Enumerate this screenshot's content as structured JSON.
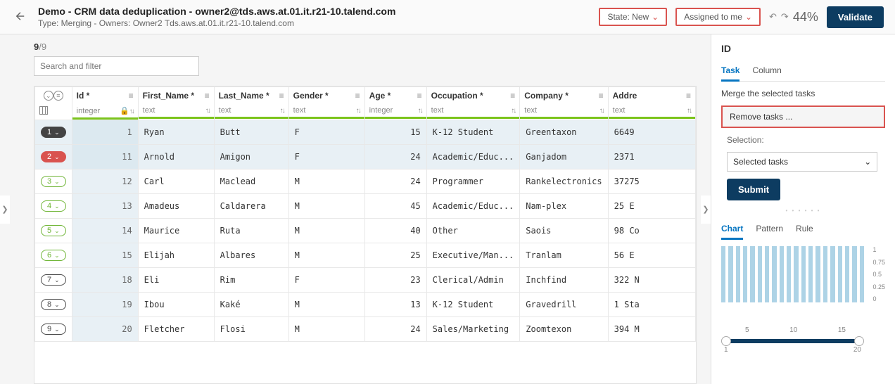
{
  "header": {
    "title": "Demo - CRM data deduplication - owner2@tds.aws.at.01.it.r21-10.talend.com",
    "subtitle": "Type: Merging - Owners: Owner2 Tds.aws.at.01.it.r21-10.talend.com",
    "state": "State: New",
    "assigned": "Assigned to me",
    "percent": "44%",
    "validate": "Validate"
  },
  "count": {
    "n": "9",
    "total": "/9"
  },
  "search_placeholder": "Search and filter",
  "columns": [
    {
      "name": "",
      "type": ""
    },
    {
      "name": "Id *",
      "type": "integer",
      "lock": true
    },
    {
      "name": "First_Name *",
      "type": "text"
    },
    {
      "name": "Last_Name *",
      "type": "text"
    },
    {
      "name": "Gender *",
      "type": "text"
    },
    {
      "name": "Age *",
      "type": "integer"
    },
    {
      "name": "Occupation *",
      "type": "text"
    },
    {
      "name": "Company *",
      "type": "text"
    },
    {
      "name": "Addre",
      "type": "text"
    }
  ],
  "rows": [
    {
      "pill": "1",
      "pillClass": "dark",
      "hl": true,
      "id": "1",
      "fn": "Ryan",
      "ln": "Butt",
      "g": "F",
      "age": "15",
      "occ": "K-12 Student",
      "co": "Greentaxon",
      "addr": "6649"
    },
    {
      "pill": "2",
      "pillClass": "red",
      "hl": true,
      "id": "11",
      "fn": "Arnold",
      "ln": "Amigon",
      "g": "F",
      "age": "24",
      "occ": "Academic/Educ...",
      "co": "Ganjadom",
      "addr": "2371"
    },
    {
      "pill": "3",
      "pillClass": "green",
      "id": "12",
      "fn": "Carl",
      "ln": "Maclead",
      "g": "M",
      "age": "24",
      "occ": "Programmer",
      "co": "Rankelectronics",
      "addr": "37275"
    },
    {
      "pill": "4",
      "pillClass": "green",
      "id": "13",
      "fn": "Amadeus",
      "ln": "Caldarera",
      "g": "M",
      "age": "45",
      "occ": "Academic/Educ...",
      "co": "Nam-plex",
      "addr": "25 E"
    },
    {
      "pill": "5",
      "pillClass": "green",
      "id": "14",
      "fn": "Maurice",
      "ln": "Ruta",
      "g": "M",
      "age": "40",
      "occ": "Other",
      "co": "Saois",
      "addr": "98 Co"
    },
    {
      "pill": "6",
      "pillClass": "green",
      "id": "15",
      "fn": "Elijah",
      "ln": "Albares",
      "g": "M",
      "age": "25",
      "occ": "Executive/Man...",
      "co": "Tranlam",
      "addr": "56 E"
    },
    {
      "pill": "7",
      "pillClass": "",
      "id": "18",
      "fn": "Eli",
      "ln": "Rim",
      "g": "F",
      "age": "23",
      "occ": "Clerical/Admin",
      "co": "Inchfind",
      "addr": "322 N"
    },
    {
      "pill": "8",
      "pillClass": "",
      "id": "19",
      "fn": "Ibou",
      "ln": "Kaké",
      "g": "M",
      "age": "13",
      "occ": "K-12 Student",
      "co": "Gravedrill",
      "addr": "1 Sta"
    },
    {
      "pill": "9",
      "pillClass": "",
      "id": "20",
      "fn": "Fletcher",
      "ln": "Flosi",
      "g": "M",
      "age": "24",
      "occ": "Sales/Marketing",
      "co": "Zoomtexon",
      "addr": "394 M"
    }
  ],
  "side": {
    "title": "ID",
    "tabs": [
      "Task",
      "Column"
    ],
    "instr": "Merge the selected tasks",
    "remove": "Remove tasks ...",
    "selLabel": "Selection:",
    "selValue": "Selected tasks",
    "submit": "Submit",
    "tabs2": [
      "Chart",
      "Pattern",
      "Rule"
    ],
    "ylabels": [
      "1",
      "0.75",
      "0.5",
      "0.25",
      "0"
    ],
    "ticks": [
      "5",
      "10",
      "15"
    ],
    "range": [
      "1",
      "20"
    ]
  },
  "chart_data": {
    "type": "bar",
    "title": "",
    "xlabel": "Id",
    "ylabel": "",
    "ylim": [
      0,
      1
    ],
    "x_range": [
      1,
      20
    ],
    "ticks": [
      5,
      10,
      15
    ],
    "categories": [
      1,
      2,
      3,
      4,
      5,
      6,
      7,
      8,
      9,
      10,
      11,
      12,
      13,
      14,
      15,
      16,
      17,
      18,
      19,
      20
    ],
    "values": [
      1,
      1,
      1,
      1,
      1,
      1,
      1,
      1,
      1,
      1,
      1,
      1,
      1,
      1,
      1,
      1,
      1,
      1,
      1,
      1
    ]
  }
}
